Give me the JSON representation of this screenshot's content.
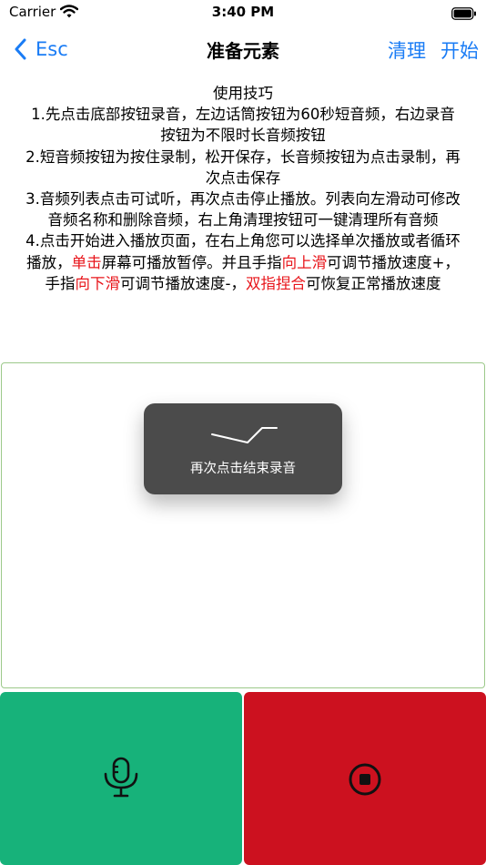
{
  "status_bar": {
    "carrier": "Carrier",
    "time": "3:40 PM"
  },
  "nav": {
    "back_label": "Esc",
    "title": "准备元素",
    "clean_label": "清理",
    "start_label": "开始"
  },
  "tips": {
    "heading": "使用技巧",
    "line1": "1.先点击底部按钮录音，左边话筒按钮为60秒短音频，右边录音按钮为不限时长音频按钮",
    "line2": "2.短音频按钮为按住录制，松开保存，长音频按钮为点击录制，再次点击保存",
    "line3": "3.音频列表点击可试听，再次点击停止播放。列表向左滑动可修改音频名称和删除音频，右上角清理按钮可一键清理所有音频",
    "line4_a": "4.点击开始进入播放页面，在右上角您可以选择单次播放或者循环播放，",
    "line4_red1": "单击",
    "line4_b": "屏幕可播放暂停。并且手指",
    "line4_red2": "向上滑",
    "line4_c": "可调节播放速度+，手指",
    "line4_red3": "向下滑",
    "line4_d": "可调节播放速度-，",
    "line4_red4": "双指捏合",
    "line4_e": "可恢复正常播放速度"
  },
  "toast": {
    "text": "再次点击结束录音"
  },
  "buttons": {
    "short_icon": "microphone-icon",
    "long_icon": "record-stop-icon"
  },
  "colors": {
    "accent": "#1a7cf5",
    "red_text": "#e8141a",
    "short_button": "#17b27a",
    "long_button": "#cc111f",
    "toast_bg": "#4b4b4b"
  }
}
